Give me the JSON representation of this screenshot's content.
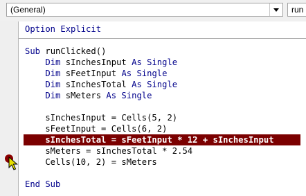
{
  "toolbar": {
    "object_combo": "(General)",
    "procedure_combo": "run"
  },
  "code": {
    "lines": [
      [
        {
          "t": "Option Explicit",
          "k": 1
        }
      ],
      [],
      [
        {
          "t": "Sub ",
          "k": 1
        },
        {
          "t": "runClicked()"
        }
      ],
      [
        {
          "t": "    "
        },
        {
          "t": "Dim",
          "k": 1
        },
        {
          "t": " sInchesInput "
        },
        {
          "t": "As Single",
          "k": 1
        }
      ],
      [
        {
          "t": "    "
        },
        {
          "t": "Dim",
          "k": 1
        },
        {
          "t": " sFeetInput "
        },
        {
          "t": "As Single",
          "k": 1
        }
      ],
      [
        {
          "t": "    "
        },
        {
          "t": "Dim",
          "k": 1
        },
        {
          "t": " sInchesTotal "
        },
        {
          "t": "As Single",
          "k": 1
        }
      ],
      [
        {
          "t": "    "
        },
        {
          "t": "Dim",
          "k": 1
        },
        {
          "t": " sMeters "
        },
        {
          "t": "As Single",
          "k": 1
        }
      ],
      [],
      [
        {
          "t": "    sInchesInput = Cells(5, 2)"
        }
      ],
      [
        {
          "t": "    sFeetInput = Cells(6, 2)"
        }
      ],
      [
        {
          "t": "    sInchesTotal = sFeetInput * 12 + sInchesInput"
        }
      ],
      [
        {
          "t": "    sMeters = sInchesTotal * 2.54"
        }
      ],
      [
        {
          "t": "    Cells(10, 2) = sMeters"
        }
      ],
      [],
      [
        {
          "t": "End Sub",
          "k": 1
        }
      ]
    ],
    "highlighted_line": 10
  },
  "colors": {
    "keyword": "#00008b",
    "highlight_bg": "#7b0000",
    "breakpoint": "#8b0000",
    "exec_arrow": "#e8e000"
  }
}
